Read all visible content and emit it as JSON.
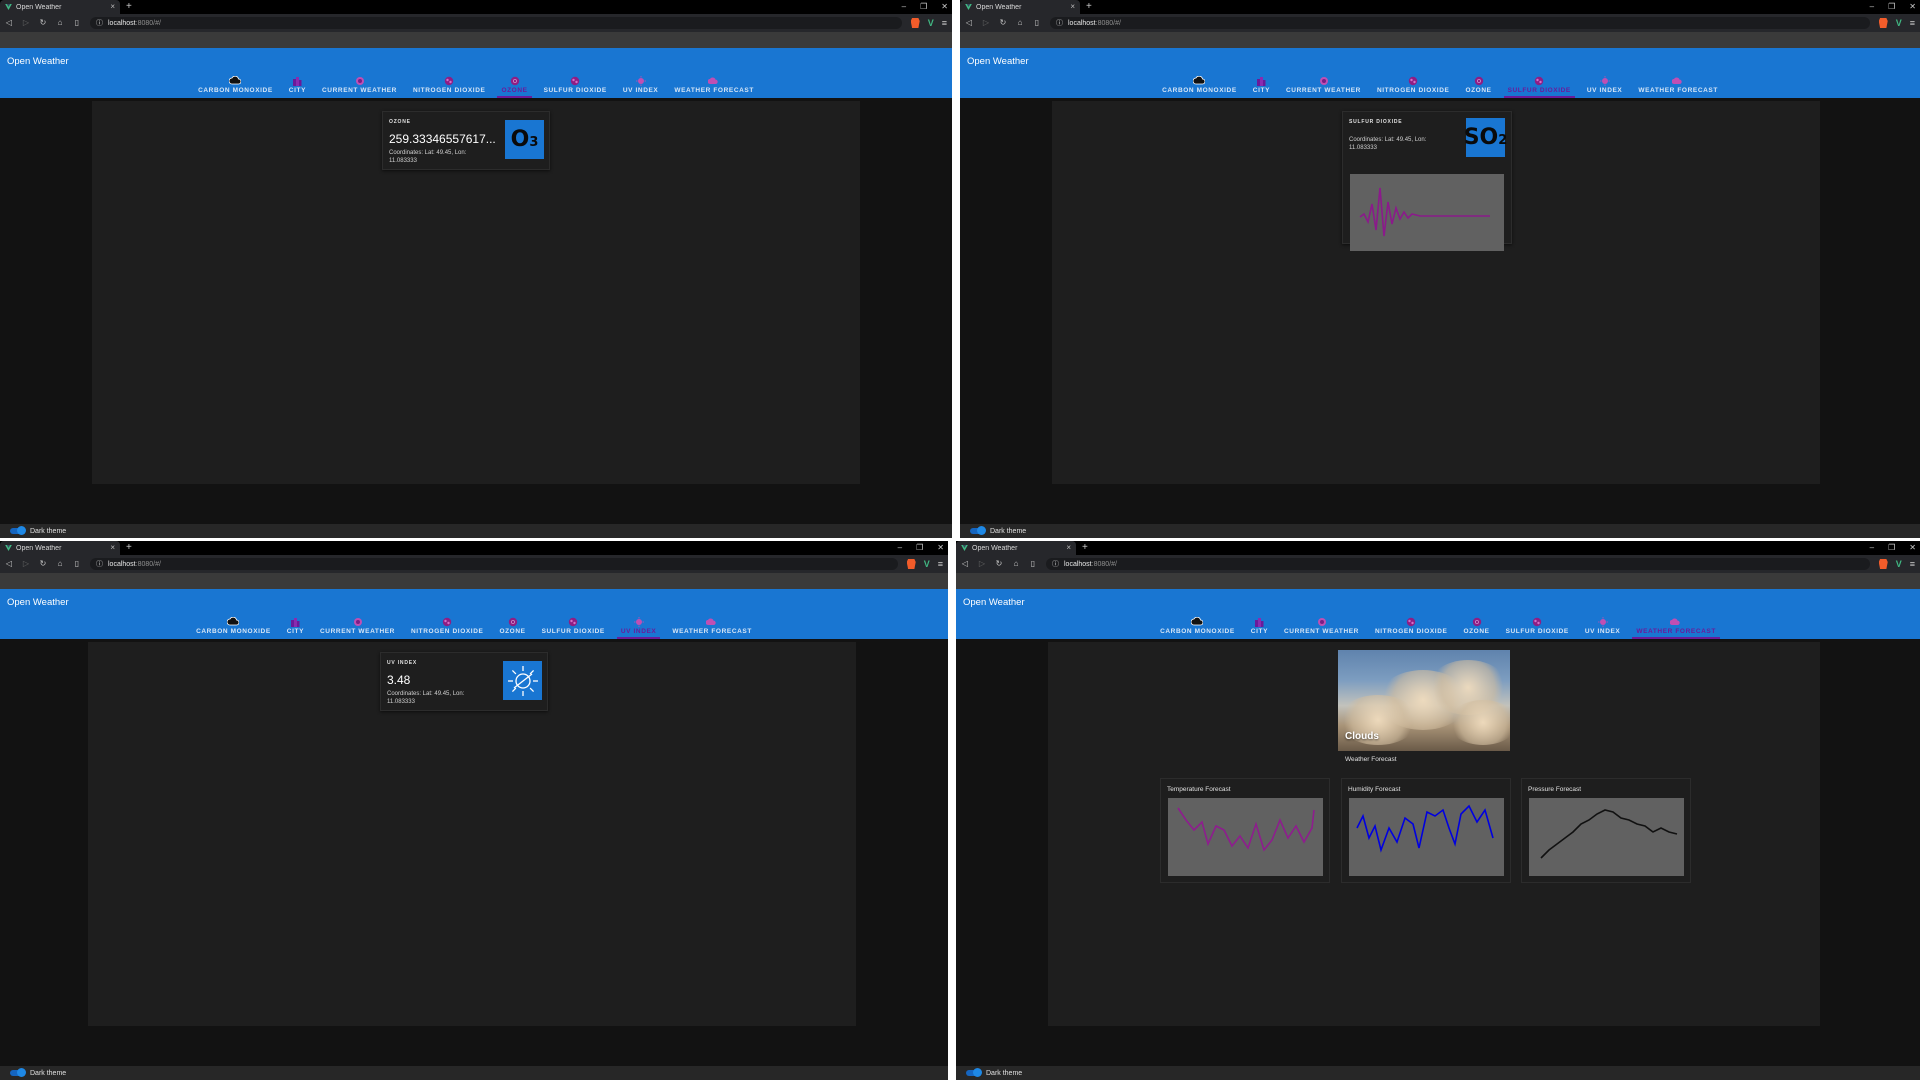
{
  "browser": {
    "tab_title": "Open Weather",
    "url_host": "localhost",
    "url_path": ":8080/#/"
  },
  "app": {
    "title": "Open Weather",
    "footer_label": "Dark theme",
    "nav": [
      {
        "label": "CARBON MONOXIDE",
        "icon": "cloud-icon"
      },
      {
        "label": "CITY",
        "icon": "city-icon"
      },
      {
        "label": "CURRENT WEATHER",
        "icon": "sun-cloud-icon"
      },
      {
        "label": "NITROGEN DIOXIDE",
        "icon": "molecule-icon"
      },
      {
        "label": "OZONE",
        "icon": "ozone-icon"
      },
      {
        "label": "SULFUR DIOXIDE",
        "icon": "molecule-icon"
      },
      {
        "label": "UV INDEX",
        "icon": "uv-icon"
      },
      {
        "label": "WEATHER FORECAST",
        "icon": "forecast-icon"
      }
    ]
  },
  "colors": {
    "appbar": "#1976d2",
    "active_tab": "#6a1b9a",
    "icon_magenta": "#b3309b",
    "so2_line": "#8b1a8b",
    "temp_line": "#8e1d8e",
    "humidity_line": "#0000e0",
    "pressure_line": "#111111"
  },
  "screens": [
    {
      "active_tab": 4,
      "card": {
        "overline": "OZONE",
        "value": "259.33346557617...",
        "coords_line1": "Coordinates: Lat: 49.45, Lon:",
        "coords_line2": "11.083333",
        "badge": "O3"
      }
    },
    {
      "active_tab": 5,
      "card": {
        "overline": "SULFUR DIOXIDE",
        "coords_line1": "Coordinates: Lat: 49.45, Lon:",
        "coords_line2": "11.083333",
        "badge": "SO2"
      }
    },
    {
      "active_tab": 6,
      "card": {
        "overline": "UV INDEX",
        "value": "3.48",
        "coords_line1": "Coordinates: Lat: 49.45, Lon:",
        "coords_line2": "11.083333",
        "badge": "sun-icon"
      }
    },
    {
      "active_tab": 7,
      "weather_image_label": "Clouds",
      "weather_caption": "Weather Forecast",
      "forecasts": [
        {
          "title": "Temperature Forecast"
        },
        {
          "title": "Humidity Forecast"
        },
        {
          "title": "Pressure Forecast"
        }
      ]
    }
  ]
}
